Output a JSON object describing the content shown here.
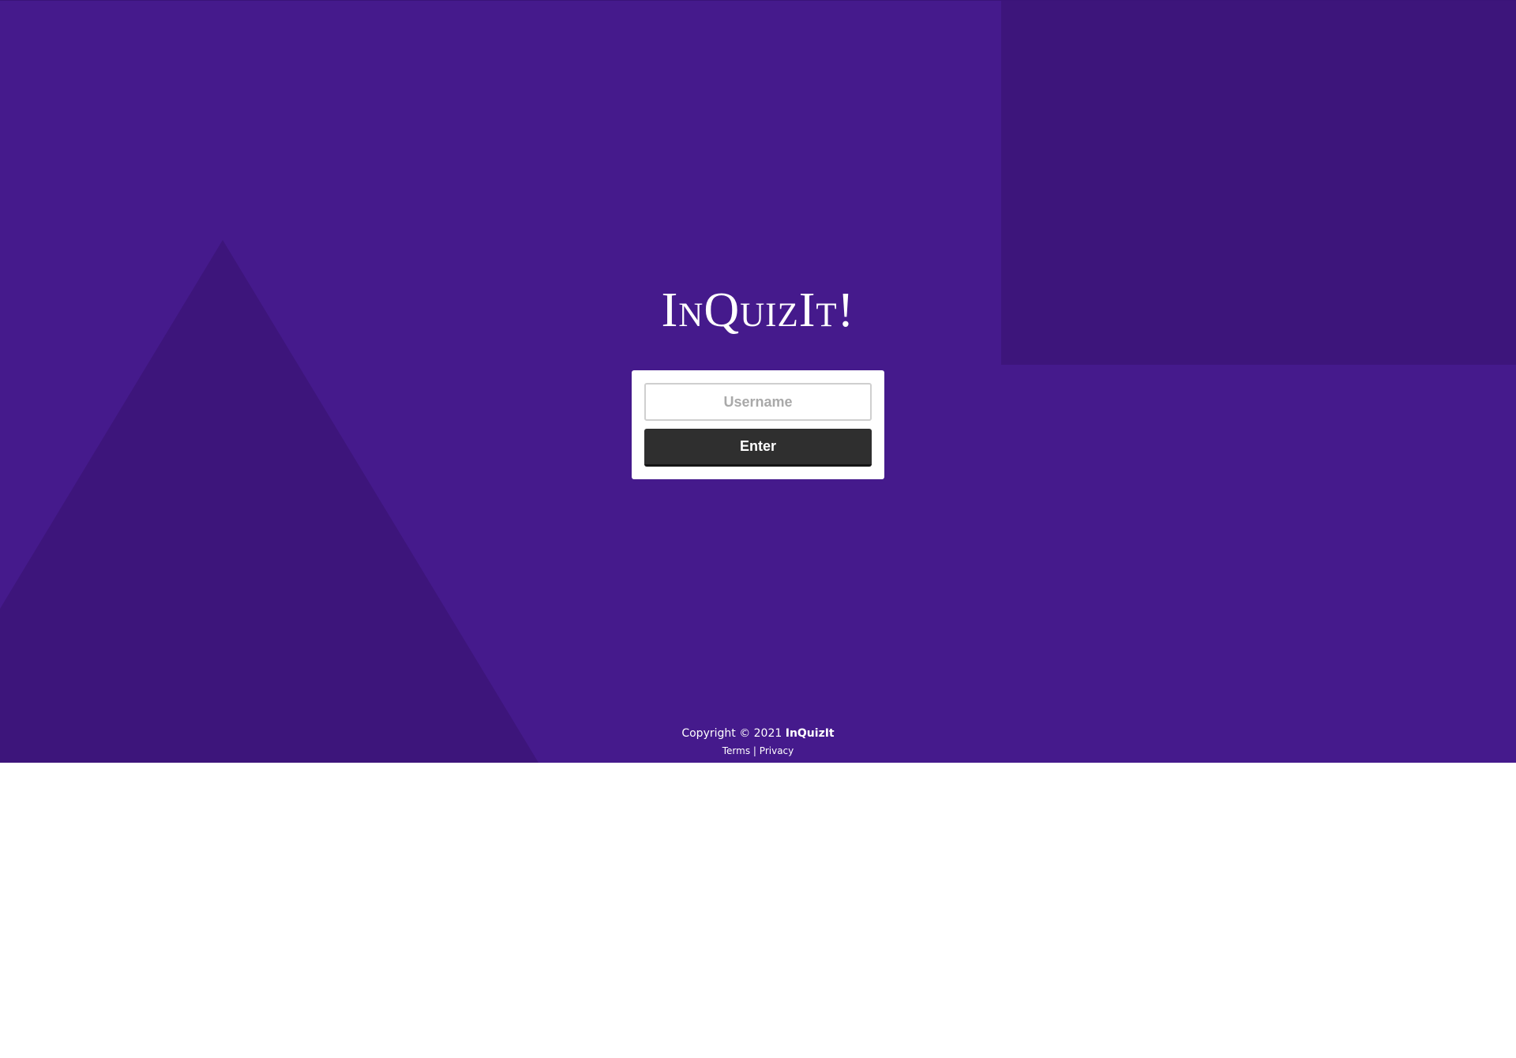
{
  "app": {
    "title": "InQuizIt!"
  },
  "login": {
    "username_placeholder": "Username",
    "username_value": "",
    "enter_label": "Enter"
  },
  "footer": {
    "copyright_prefix": "Copyright © 2021",
    "brand": "InQuizIt",
    "terms_label": "Terms",
    "separator": "|",
    "privacy_label": "Privacy"
  },
  "colors": {
    "background": "#451a8c",
    "shape": "#3d157b",
    "button": "#2f2f2f",
    "card": "#ffffff"
  }
}
